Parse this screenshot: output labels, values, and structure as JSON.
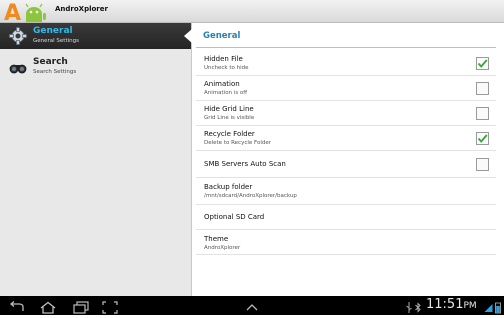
{
  "app": {
    "title": "AndroXplorer",
    "logo_letter": "A"
  },
  "sidebar": {
    "items": [
      {
        "label": "General",
        "subtitle": "General Settings",
        "icon": "gear-icon",
        "selected": true
      },
      {
        "label": "Search",
        "subtitle": "Search Settings",
        "icon": "binoculars-icon",
        "selected": false
      }
    ]
  },
  "content": {
    "section_title": "General",
    "prefs": [
      {
        "title": "Hidden File",
        "subtitle": "Uncheck to hide",
        "checkbox": true,
        "checked": true
      },
      {
        "title": "Animation",
        "subtitle": "Animation is off",
        "checkbox": true,
        "checked": false
      },
      {
        "title": "Hide Grid Line",
        "subtitle": "Grid Line is visible",
        "checkbox": true,
        "checked": false
      },
      {
        "title": "Recycle Folder",
        "subtitle": "Delete to Recycle Folder",
        "checkbox": true,
        "checked": true
      },
      {
        "title": "SMB Servers Auto Scan",
        "subtitle": "",
        "checkbox": true,
        "checked": false
      },
      {
        "title": "Backup folder",
        "subtitle": "/mnt/sdcard/AndroXplorer/backup",
        "checkbox": false
      },
      {
        "title": "Optional SD Card",
        "subtitle": "",
        "checkbox": false
      },
      {
        "title": "Theme",
        "subtitle": "AndroXplorer",
        "checkbox": false
      }
    ]
  },
  "navbar": {
    "buttons": [
      "back-icon",
      "home-icon",
      "recent-apps-icon",
      "menu-up-icon"
    ],
    "status_icons": [
      "usb-icon",
      "bluetooth-icon",
      "wifi-icon"
    ],
    "clock_time": "11:51",
    "clock_ampm": "PM"
  },
  "colors": {
    "accent": "#2a7fb5",
    "selected_title": "#35b7e8",
    "check": "#3aa63a"
  }
}
